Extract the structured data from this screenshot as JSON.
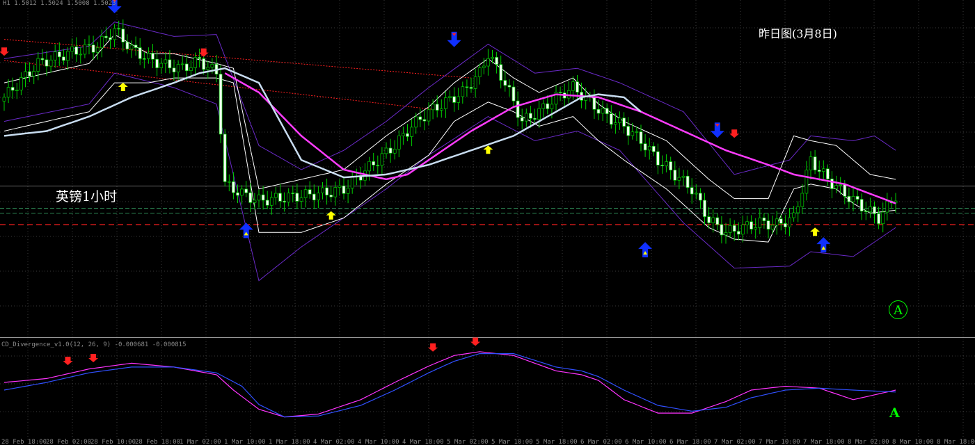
{
  "header": {
    "info": "H1  1.5012 1.5024 1.5008 1.5023"
  },
  "subwindow": {
    "label": "CD_Divergence_v1.0(12, 26, 9) -0.000681 -0.000815"
  },
  "annotations": {
    "yesterday_chart": "昨日图(3月8日)",
    "pair_timeframe": "英镑1小时",
    "marker_a_circle": "A",
    "marker_a_low": "A"
  },
  "colors": {
    "background": "#000000",
    "grid": "#3a3a3a",
    "candle_up_body": "#000000",
    "candle_down_body": "#f0fff0",
    "candle_outline": "#00d000",
    "bollinger_outer": "#6a2ac8",
    "envelope_inner": "#ffffff",
    "ma_slow": "#ff3cff",
    "ma_fast": "#c8dcf0",
    "trendline": "#ff2020",
    "hline_green": "#2e8b57",
    "hline_red": "#ff2020",
    "hline_gray": "#666666",
    "osc_signal": "#ff33ff",
    "osc_main": "#3050ff",
    "arrow_up_small": "#ffff00",
    "arrow_down_small": "#ff2020",
    "arrow_big_blue": "#1030ff",
    "label_green": "#00ff00"
  },
  "icons": [
    "down-arrow-signal-icon",
    "up-arrow-signal-icon",
    "big-down-arrow-icon",
    "big-up-arrow-icon"
  ],
  "chart_data": [
    {
      "type": "candlestick",
      "title": "",
      "grid": true,
      "x_tick_labels": [
        "28 Feb 18:00",
        "28 Feb 02:00",
        "28 Feb 10:00",
        "28 Feb 18:00",
        "1 Mar 02:00",
        "1 Mar 10:00",
        "1 Mar 18:00",
        "4 Mar 02:00",
        "4 Mar 10:00",
        "4 Mar 18:00",
        "5 Mar 02:00",
        "5 Mar 10:00",
        "5 Mar 18:00",
        "6 Mar 02:00",
        "6 Mar 10:00",
        "6 Mar 18:00",
        "7 Mar 02:00",
        "7 Mar 10:00",
        "7 Mar 18:00",
        "8 Mar 02:00",
        "8 Mar 10:00",
        "8 Mar 18:00"
      ],
      "ylim": [
        1.488,
        1.522
      ],
      "candle_keypoints": {
        "index": [
          0,
          8,
          16,
          22,
          26,
          30,
          34,
          38,
          42,
          46,
          50,
          52,
          56,
          60,
          64,
          68,
          72,
          76,
          80,
          84,
          88,
          92,
          96,
          100,
          104,
          108,
          112,
          114,
          118,
          122,
          126,
          130,
          134,
          138,
          142,
          146,
          150,
          154,
          158,
          162,
          166,
          170,
          174,
          178,
          182,
          186,
          190,
          194,
          198,
          202,
          206,
          210
        ],
        "close": [
          1.5125,
          1.516,
          1.5172,
          1.5178,
          1.5195,
          1.5175,
          1.5165,
          1.5158,
          1.5155,
          1.5163,
          1.515,
          1.5035,
          1.5025,
          1.5018,
          1.502,
          1.5022,
          1.5024,
          1.5026,
          1.503,
          1.5045,
          1.506,
          1.5075,
          1.5095,
          1.511,
          1.512,
          1.513,
          1.515,
          1.517,
          1.514,
          1.51,
          1.511,
          1.5125,
          1.5135,
          1.512,
          1.5105,
          1.5095,
          1.508,
          1.506,
          1.5045,
          1.503,
          1.4998,
          1.4985,
          1.499,
          1.4995,
          1.4993,
          1.5,
          1.506,
          1.504,
          1.5025,
          1.5012,
          1.5,
          1.5023
        ]
      },
      "series": [
        {
          "name": "",
          "role": "upper-bollinger",
          "index": [
            0,
            20,
            26,
            40,
            50,
            60,
            70,
            80,
            90,
            100,
            114,
            125,
            135,
            145,
            160,
            172,
            185,
            190,
            200,
            205,
            210
          ],
          "values": [
            1.5165,
            1.5178,
            1.5203,
            1.5188,
            1.519,
            1.5075,
            1.505,
            1.507,
            1.51,
            1.5135,
            1.518,
            1.515,
            1.5155,
            1.514,
            1.511,
            1.5045,
            1.506,
            1.5085,
            1.508,
            1.5085,
            1.507
          ]
        },
        {
          "name": "",
          "role": "lower-bollinger",
          "index": [
            0,
            20,
            26,
            40,
            50,
            60,
            70,
            80,
            90,
            100,
            114,
            125,
            135,
            145,
            160,
            172,
            185,
            190,
            200,
            205,
            210
          ],
          "values": [
            1.51,
            1.5118,
            1.515,
            1.5135,
            1.5118,
            1.4935,
            1.497,
            1.5,
            1.503,
            1.5065,
            1.5105,
            1.508,
            1.509,
            1.507,
            1.4995,
            1.4948,
            1.495,
            1.4965,
            1.496,
            1.4975,
            1.499
          ]
        },
        {
          "name": "",
          "role": "upper-envelope",
          "index": [
            0,
            20,
            26,
            34,
            40,
            50,
            54,
            60,
            70,
            80,
            90,
            100,
            106,
            114,
            120,
            126,
            134,
            140,
            146,
            156,
            166,
            172,
            180,
            186,
            190,
            196,
            200,
            204,
            210
          ],
          "values": [
            1.514,
            1.516,
            1.519,
            1.517,
            1.517,
            1.516,
            1.5155,
            1.503,
            1.504,
            1.505,
            1.5085,
            1.5115,
            1.514,
            1.5165,
            1.5145,
            1.513,
            1.5145,
            1.5118,
            1.51,
            1.508,
            1.504,
            1.502,
            1.502,
            1.5085,
            1.508,
            1.5075,
            1.506,
            1.5045,
            1.504
          ]
        },
        {
          "name": "",
          "role": "lower-envelope",
          "index": [
            0,
            20,
            26,
            34,
            40,
            50,
            54,
            60,
            70,
            80,
            90,
            100,
            106,
            114,
            120,
            126,
            134,
            140,
            146,
            156,
            166,
            172,
            180,
            186,
            190,
            196,
            200,
            204,
            210
          ],
          "values": [
            1.509,
            1.511,
            1.514,
            1.514,
            1.5145,
            1.5145,
            1.514,
            1.4985,
            1.4985,
            1.5,
            1.5035,
            1.5065,
            1.51,
            1.512,
            1.511,
            1.5095,
            1.5105,
            1.508,
            1.506,
            1.503,
            1.499,
            1.4978,
            1.4975,
            1.503,
            1.5035,
            1.503,
            1.5015,
            1.5005,
            1.5008
          ]
        },
        {
          "name": "",
          "role": "slow-ma",
          "index": [
            52,
            60,
            70,
            80,
            90,
            95,
            100,
            110,
            120,
            130,
            140,
            150,
            160,
            170,
            180,
            186,
            192,
            198,
            204,
            210
          ],
          "values": [
            1.515,
            1.513,
            1.5085,
            1.505,
            1.504,
            1.5045,
            1.506,
            1.509,
            1.5115,
            1.5128,
            1.5125,
            1.511,
            1.509,
            1.507,
            1.5055,
            1.5045,
            1.504,
            1.5035,
            1.5025,
            1.5015
          ]
        },
        {
          "name": "",
          "role": "fast-ma",
          "index": [
            0,
            10,
            20,
            30,
            40,
            46,
            52,
            60,
            70,
            80,
            90,
            100,
            110,
            120,
            130,
            136,
            140,
            146,
            150
          ],
          "values": [
            1.5085,
            1.509,
            1.5105,
            1.5125,
            1.514,
            1.515,
            1.5155,
            1.514,
            1.506,
            1.5042,
            1.5045,
            1.5055,
            1.507,
            1.5085,
            1.511,
            1.5125,
            1.5128,
            1.5125,
            1.511
          ]
        },
        {
          "name": "",
          "role": "trendline",
          "index": [
            0,
            110
          ],
          "values": [
            1.5185,
            1.5145
          ]
        },
        {
          "name": "",
          "role": "trendline",
          "index": [
            0,
            102
          ],
          "values": [
            1.5163,
            1.5112
          ]
        }
      ],
      "horizontal_lines": [
        {
          "role": "gray",
          "value": 1.5033
        },
        {
          "role": "green-dash",
          "value": 1.501
        },
        {
          "role": "green-dash",
          "value": 1.5005
        },
        {
          "role": "red-dash",
          "value": 1.4993
        }
      ],
      "signals": [
        {
          "type": "down-small",
          "index": 0,
          "value": 1.5168
        },
        {
          "type": "down-big-blue",
          "index": 26,
          "value": 1.5212
        },
        {
          "type": "up-small",
          "index": 28,
          "value": 1.514
        },
        {
          "type": "down-small",
          "index": 47,
          "value": 1.5167
        },
        {
          "type": "up-big-blue",
          "index": 57,
          "value": 1.4995
        },
        {
          "type": "up-small",
          "index": 77,
          "value": 1.5007
        },
        {
          "type": "down-big-blue",
          "index": 106,
          "value": 1.5177
        },
        {
          "type": "up-small",
          "index": 114,
          "value": 1.5075
        },
        {
          "type": "up-big-blue",
          "index": 151,
          "value": 1.4975
        },
        {
          "type": "down-big-blue",
          "index": 168,
          "value": 1.5083
        },
        {
          "type": "down-small",
          "index": 172,
          "value": 1.5083
        },
        {
          "type": "up-small",
          "index": 191,
          "value": 1.499
        },
        {
          "type": "up-big-blue",
          "index": 193,
          "value": 1.498
        }
      ]
    },
    {
      "type": "line",
      "title": "",
      "grid": true,
      "ylim": [
        -0.005,
        0.005
      ],
      "series": [
        {
          "name": "",
          "role": "signal-line",
          "index": [
            0,
            10,
            20,
            30,
            40,
            50,
            54,
            60,
            66,
            74,
            84,
            92,
            100,
            106,
            112,
            120,
            130,
            136,
            140,
            146,
            154,
            162,
            170,
            176,
            184,
            192,
            200,
            210
          ],
          "values": [
            0.0008,
            0.0012,
            0.0022,
            0.0028,
            0.0024,
            0.0016,
            0.0,
            -0.002,
            -0.0028,
            -0.0025,
            -0.001,
            0.0008,
            0.0025,
            0.0036,
            0.004,
            0.0036,
            0.002,
            0.0016,
            0.001,
            -0.001,
            -0.0024,
            -0.0024,
            -0.0012,
            0.0,
            0.0004,
            0.0002,
            -0.001,
            0.0
          ]
        },
        {
          "name": "",
          "role": "main-line",
          "index": [
            0,
            10,
            20,
            30,
            40,
            50,
            56,
            60,
            66,
            74,
            84,
            92,
            100,
            106,
            112,
            120,
            130,
            136,
            140,
            146,
            154,
            162,
            170,
            176,
            184,
            192,
            200,
            210
          ],
          "values": [
            0.0,
            0.0008,
            0.0018,
            0.0024,
            0.0024,
            0.0018,
            0.0004,
            -0.0015,
            -0.0028,
            -0.0027,
            -0.0016,
            0.0,
            0.0018,
            0.003,
            0.0038,
            0.0038,
            0.0024,
            0.002,
            0.0014,
            0.0,
            -0.0016,
            -0.0022,
            -0.0018,
            -0.0008,
            0.0,
            0.0002,
            0.0,
            -0.0002
          ]
        }
      ],
      "signals": [
        {
          "type": "down-small",
          "index": 15,
          "value": 0.0026
        },
        {
          "type": "down-small",
          "index": 21,
          "value": 0.0029
        },
        {
          "type": "down-small",
          "index": 101,
          "value": 0.004
        },
        {
          "type": "down-small",
          "index": 111,
          "value": 0.0046
        }
      ]
    }
  ]
}
